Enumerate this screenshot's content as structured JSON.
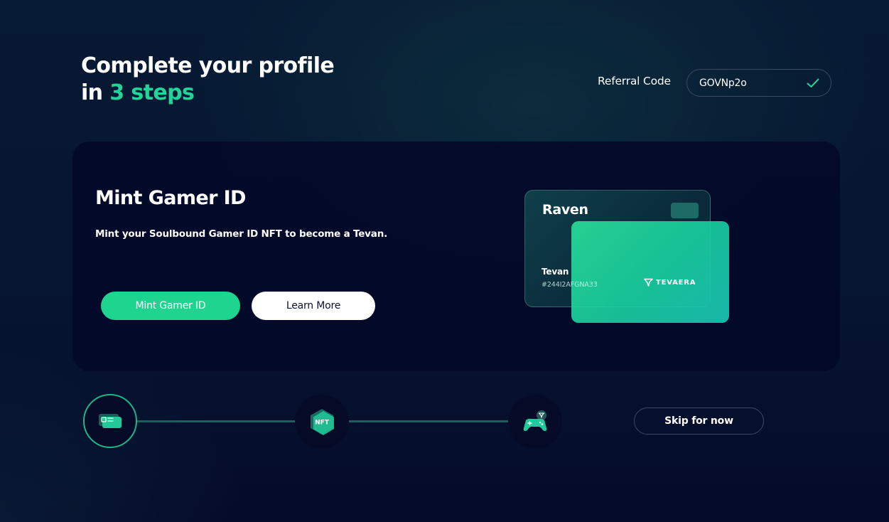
{
  "header": {
    "title_line1": "Complete your profile",
    "title_line2_prefix": "in ",
    "title_line2_accent": "3 steps"
  },
  "referral": {
    "label": "Referral Code",
    "value": "GOVNp2o",
    "icon": "check-icon"
  },
  "card": {
    "title": "Mint Gamer ID",
    "description": "Mint your Soulbound Gamer ID NFT to become a Tevan.",
    "primary_button": "Mint Gamer ID",
    "secondary_button": "Learn More"
  },
  "id_card": {
    "name": "Raven",
    "user": "Tevan",
    "code": "#244I2AFGNA33",
    "brand": "TEVAERA"
  },
  "steps": [
    {
      "icon": "id-card-icon",
      "active": true
    },
    {
      "icon": "nft-icon",
      "label": "NFT",
      "active": false
    },
    {
      "icon": "gamepad-icon",
      "active": false
    }
  ],
  "skip_button": "Skip for now",
  "colors": {
    "accent": "#22d39a",
    "primary_button": "#1dd58e",
    "background": "#061530",
    "card": "#030828"
  }
}
